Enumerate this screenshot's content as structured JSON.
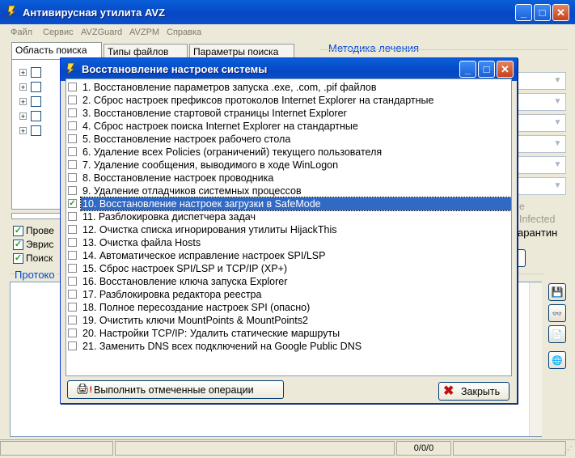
{
  "window": {
    "title": "Антивирусная утилита AVZ",
    "controls": {
      "minimize": "_",
      "maximize": "□",
      "close": "✕"
    }
  },
  "menu": [
    "Файл",
    "Сервис",
    "AVZGuard",
    "AVZPM",
    "Справка"
  ],
  "tabs": [
    "Область поиска",
    "Типы файлов",
    "Параметры поиска"
  ],
  "treatment_label": "Методика лечения",
  "right_fragments": {
    "e": "е",
    "infected": "Infected",
    "quarantine": "арантин"
  },
  "left_checks": [
    "Прове",
    "Эврис",
    "Поиск"
  ],
  "protocol_label": "Протоко",
  "status_counter": "0/0/0",
  "dialog": {
    "title": "Восстановление настроек системы",
    "controls": {
      "minimize": "_",
      "maximize": "□",
      "close": "✕"
    },
    "options": [
      {
        "label": "1. Восстановление параметров запуска .exe, .com, .pif файлов",
        "checked": false
      },
      {
        "label": "2. Сброс настроек префиксов протоколов Internet Explorer на стандартные",
        "checked": false
      },
      {
        "label": "3. Восстановление стартовой страницы Internet Explorer",
        "checked": false
      },
      {
        "label": "4. Сброс настроек поиска Internet Explorer на стандартные",
        "checked": false
      },
      {
        "label": "5. Восстановление настроек рабочего стола",
        "checked": false
      },
      {
        "label": "6. Удаление всех Policies (ограничений) текущего пользователя",
        "checked": false
      },
      {
        "label": "7. Удаление сообщения, выводимого в ходе WinLogon",
        "checked": false
      },
      {
        "label": "8. Восстановление настроек проводника",
        "checked": false
      },
      {
        "label": "9. Удаление отладчиков системных процессов",
        "checked": false
      },
      {
        "label": "10. Восстановление настроек загрузки в SafeMode",
        "checked": true
      },
      {
        "label": "11. Разблокировка диспетчера задач",
        "checked": false
      },
      {
        "label": "12. Очистка списка игнорирования утилиты HijackThis",
        "checked": false
      },
      {
        "label": "13. Очистка файла Hosts",
        "checked": false
      },
      {
        "label": "14. Автоматическое исправление настроек SPI/LSP",
        "checked": false
      },
      {
        "label": "15. Сброс настроек SPI/LSP и TCP/IP (XP+)",
        "checked": false
      },
      {
        "label": "16. Восстановление ключа запуска Explorer",
        "checked": false
      },
      {
        "label": "17. Разблокировка редактора реестра",
        "checked": false
      },
      {
        "label": "18. Полное пересоздание настроек SPI (опасно)",
        "checked": false
      },
      {
        "label": "19. Очистить ключи MountPoints & MountPoints2",
        "checked": false
      },
      {
        "label": "20. Настройки TCP/IP: Удалить статические маршруты",
        "checked": false
      },
      {
        "label": "21. Заменить DNS всех подключений на Google Public DNS",
        "checked": false
      }
    ],
    "run_button": "Выполнить отмеченные операции",
    "close_button": "Закрыть"
  }
}
